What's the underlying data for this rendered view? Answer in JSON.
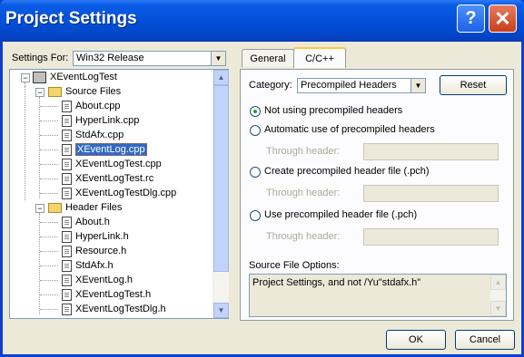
{
  "window": {
    "title": "Project Settings"
  },
  "settings_for": {
    "label": "Settings For:",
    "value": "Win32 Release"
  },
  "tree": {
    "root": "XEventLogTest",
    "source_folder": "Source Files",
    "source_files": [
      "About.cpp",
      "HyperLink.cpp",
      "StdAfx.cpp",
      "XEventLog.cpp",
      "XEventLogTest.cpp",
      "XEventLogTest.rc",
      "XEventLogTestDlg.cpp"
    ],
    "header_folder": "Header Files",
    "header_files": [
      "About.h",
      "HyperLink.h",
      "Resource.h",
      "StdAfx.h",
      "XEventLog.h",
      "XEventLogTest.h",
      "XEventLogTestDlg.h"
    ],
    "selected": "XEventLog.cpp"
  },
  "tabs": [
    {
      "label": "General"
    },
    {
      "label": "C/C++"
    }
  ],
  "category": {
    "label": "Category:",
    "value": "Precompiled Headers"
  },
  "reset_label": "Reset",
  "options": [
    {
      "label": "Not using precompiled headers",
      "checked": true
    },
    {
      "label": "Automatic use of precompiled headers",
      "checked": false
    },
    {
      "label": "Create precompiled header file (.pch)",
      "checked": false
    },
    {
      "label": "Use precompiled header file (.pch)",
      "checked": false
    }
  ],
  "through_header_label": "Through header:",
  "source_file_options": {
    "label": "Source File Options:",
    "value": "Project Settings, and not /Yu\"stdafx.h\""
  },
  "ok_label": "OK",
  "cancel_label": "Cancel"
}
